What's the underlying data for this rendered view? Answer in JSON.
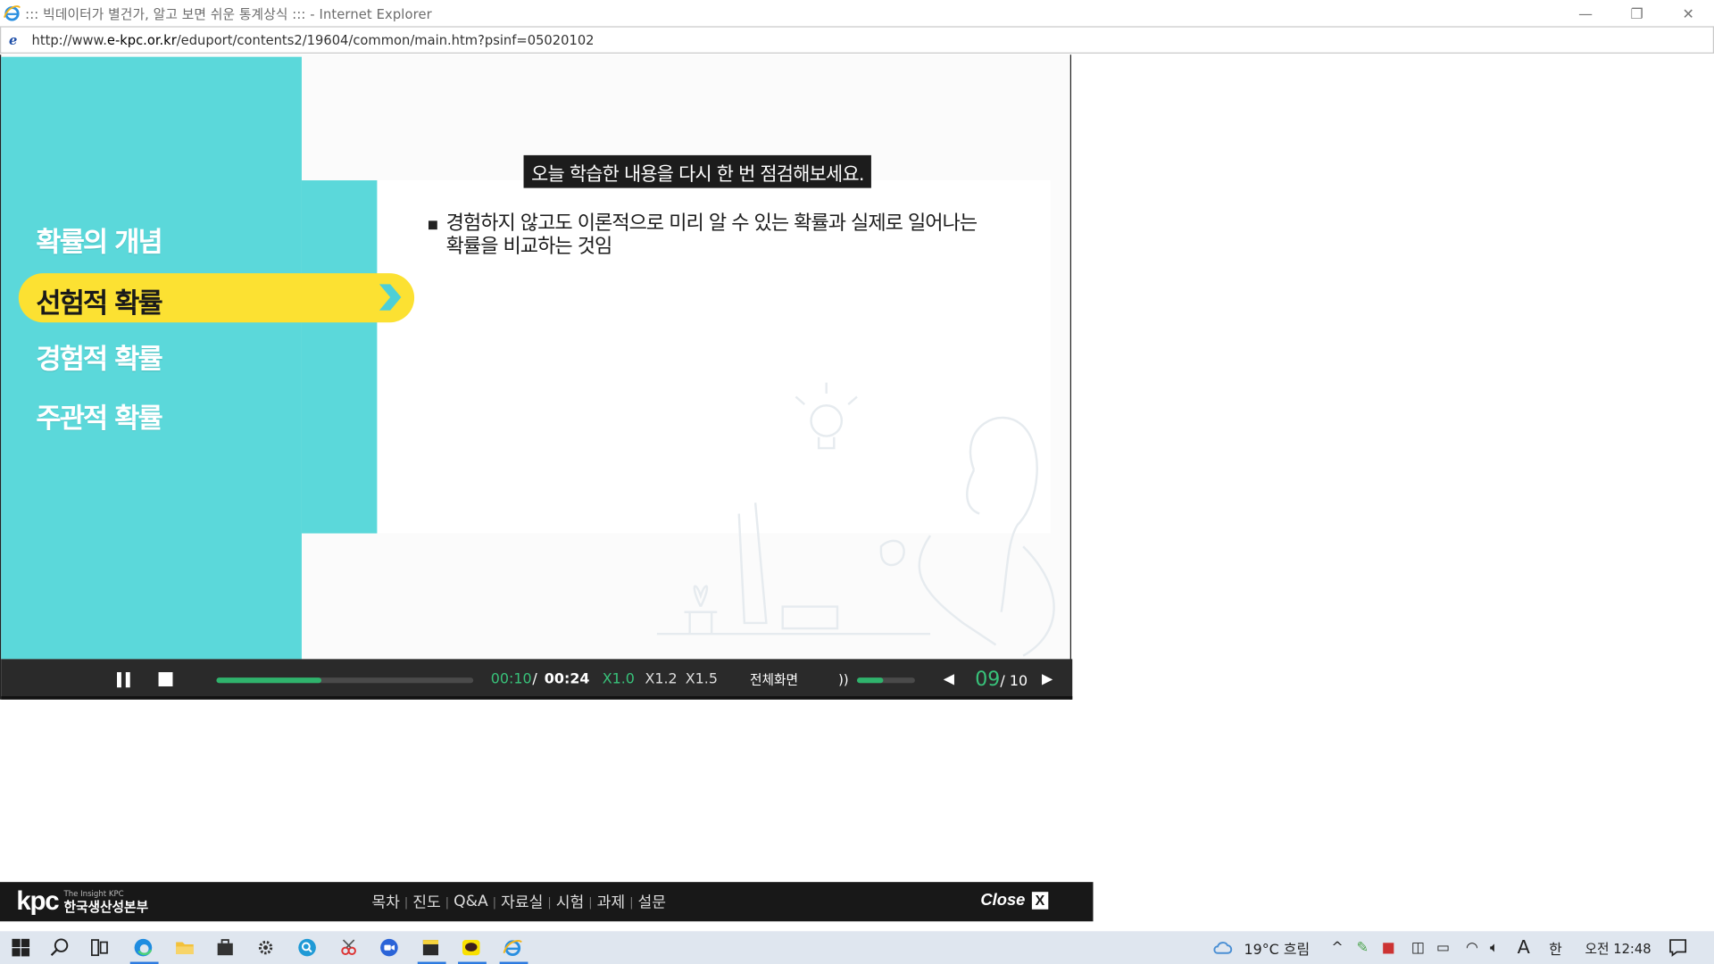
{
  "window": {
    "title": "::: 빅데이터가 별건가, 알고 보면 쉬운 통계상식 ::: - Internet Explorer",
    "minimize": "—",
    "restore": "❐",
    "close": "✕"
  },
  "address": {
    "icon": "ie-e-icon",
    "url_prefix": "http://www.",
    "url_domain": "e-kpc.or.kr",
    "url_path": "/eduport/contents2/19604/common/main.htm?psinf=05020102"
  },
  "lesson": {
    "menu": [
      {
        "label": "확률의 개념",
        "active": false
      },
      {
        "label": "선험적 확률",
        "active": true
      },
      {
        "label": "경험적 확률",
        "active": false
      },
      {
        "label": "주관적 확률",
        "active": false
      }
    ],
    "banner": "오늘 학습한 내용을 다시 한 번 점검해보세요.",
    "body_line1": "경험하지 않고도 이론적으로 미리 알 수 있는 확률과 실제로 일어나는",
    "body_line2": "확률을 비교하는 것임"
  },
  "controls": {
    "progress": 0.41,
    "time_current": "00:10",
    "time_separator": "/",
    "time_total": "00:24",
    "speeds": [
      "X1.0",
      "X1.2",
      "X1.5"
    ],
    "speed_selected": "X1.0",
    "fullscreen": "전체화면",
    "volume": 0.45,
    "volume_icon": "))",
    "page_current": "09",
    "page_total": "/ 10",
    "prev_icon": "◀",
    "next_icon": "▶"
  },
  "footer": {
    "logo_text": "kpc",
    "logo_tagline": "The Insight KPC",
    "logo_name": "한국생산성본부",
    "nav": [
      "목차",
      "진도",
      "Q&A",
      "자료실",
      "시험",
      "과제",
      "설문"
    ],
    "close_label": "Close",
    "close_x": "X"
  },
  "taskbar": {
    "weather": "19°C 흐림",
    "ime_a": "A",
    "ime_han": "한",
    "clock": "오전 12:48"
  },
  "colors": {
    "accent_cyan": "#5bd8da",
    "active_yellow": "#fce132",
    "progress_green": "#2fb36c",
    "control_bg": "#2a2a2a"
  }
}
